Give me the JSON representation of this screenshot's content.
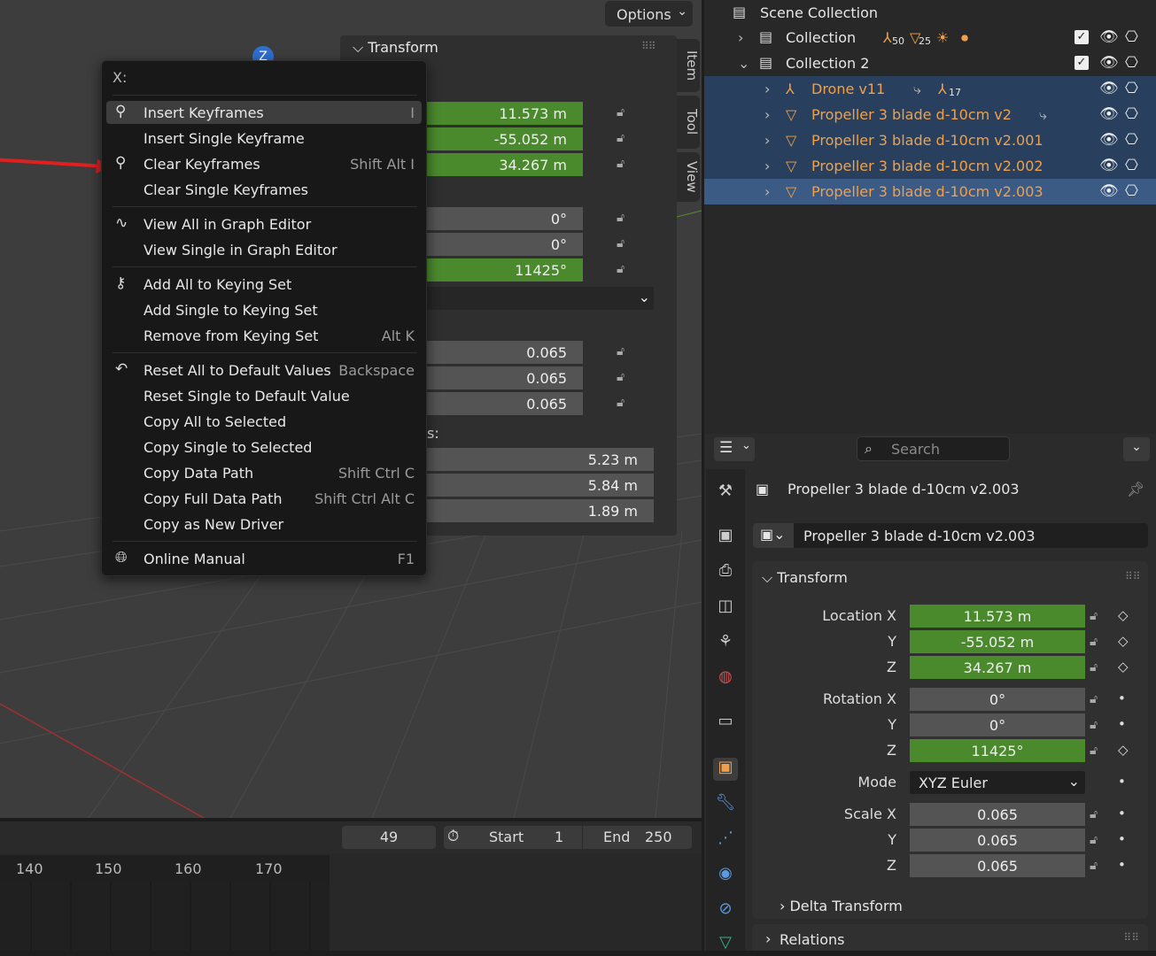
{
  "viewport": {
    "options_label": "Options",
    "gizmo_z": "Z"
  },
  "npanel": {
    "header": "Transform",
    "tabs": [
      "Item",
      "Tool",
      "View"
    ],
    "location": [
      "11.573 m",
      "-55.052 m",
      "34.267 m"
    ],
    "rotation": [
      "0°",
      "0°",
      "11425°"
    ],
    "scale": [
      "0.065",
      "0.065",
      "0.065"
    ],
    "dimensions_label": "s:",
    "dimensions": [
      "5.23 m",
      "5.84 m",
      "1.89 m"
    ]
  },
  "menu": {
    "title": "X:",
    "groups": [
      [
        {
          "label": "Insert Keyframes",
          "shortcut": "I",
          "icon": "keyframe-insert-icon",
          "highlight": true
        },
        {
          "label": "Insert Single Keyframe",
          "shortcut": ""
        },
        {
          "label": "Clear Keyframes",
          "shortcut": "Shift Alt I",
          "icon": "keyframe-clear-icon"
        },
        {
          "label": "Clear Single Keyframes",
          "shortcut": ""
        }
      ],
      [
        {
          "label": "View All in Graph Editor",
          "shortcut": "",
          "icon": "graph-editor-icon"
        },
        {
          "label": "View Single in Graph Editor",
          "shortcut": ""
        }
      ],
      [
        {
          "label": "Add All to Keying Set",
          "shortcut": "",
          "icon": "keying-set-icon"
        },
        {
          "label": "Add Single to Keying Set",
          "shortcut": ""
        },
        {
          "label": "Remove from Keying Set",
          "shortcut": "Alt K"
        }
      ],
      [
        {
          "label": "Reset All to Default Values",
          "shortcut": "Backspace",
          "icon": "reset-icon"
        },
        {
          "label": "Reset Single to Default Value",
          "shortcut": ""
        },
        {
          "label": "Copy All to Selected",
          "shortcut": ""
        },
        {
          "label": "Copy Single to Selected",
          "shortcut": ""
        },
        {
          "label": "Copy Data Path",
          "shortcut": "Shift Ctrl C"
        },
        {
          "label": "Copy Full Data Path",
          "shortcut": "Shift Ctrl Alt C"
        },
        {
          "label": "Copy as New Driver",
          "shortcut": ""
        }
      ],
      [
        {
          "label": "Online Manual",
          "shortcut": "F1",
          "icon": "globe-icon"
        }
      ]
    ]
  },
  "timeline": {
    "current_frame": "49",
    "start_label": "Start",
    "start": "1",
    "end_label": "End",
    "end": "250",
    "ticks": [
      "140",
      "150",
      "160",
      "170"
    ]
  },
  "outliner": {
    "scene_collection": "Scene Collection",
    "collection": "Collection",
    "collection_badges": [
      "50",
      "25"
    ],
    "collection2": "Collection 2",
    "items": [
      {
        "name": "Drone v11",
        "badge": "17"
      },
      {
        "name": "Propeller 3 blade d-10cm v2"
      },
      {
        "name": "Propeller 3 blade d-10cm v2.001"
      },
      {
        "name": "Propeller 3 blade d-10cm v2.002"
      },
      {
        "name": "Propeller 3 blade d-10cm v2.003"
      }
    ]
  },
  "properties": {
    "search_placeholder": "Search",
    "object_name": "Propeller 3 blade d-10cm v2.003",
    "object_field": "Propeller 3 blade d-10cm v2.003",
    "transform_header": "Transform",
    "location_label": "Location X",
    "y_label": "Y",
    "z_label": "Z",
    "location": [
      "11.573 m",
      "-55.052 m",
      "34.267 m"
    ],
    "rotation_label": "Rotation X",
    "rotation": [
      "0°",
      "0°",
      "11425°"
    ],
    "mode_label": "Mode",
    "mode_value": "XYZ Euler",
    "scale_label": "Scale X",
    "scale": [
      "0.065",
      "0.065",
      "0.065"
    ],
    "delta_header": "Delta Transform",
    "relations_header": "Relations"
  },
  "colors": {
    "accent_green": "#4a8a2d",
    "selection_blue": "#28405e",
    "active_blue": "#3b5a84",
    "object_orange": "#f0a04a"
  }
}
